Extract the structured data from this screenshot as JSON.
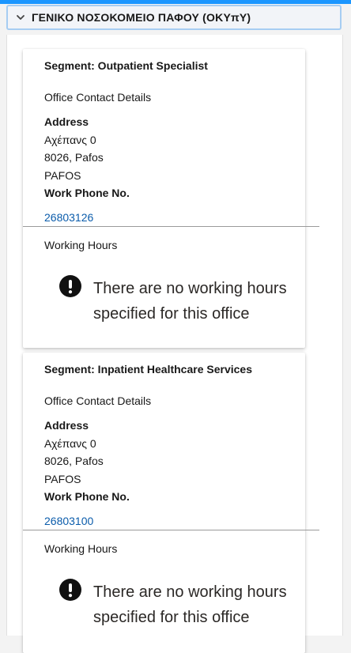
{
  "section": {
    "title": "ΓΕΝΙΚΟ ΝΟΣΟΚΟΜΕΙΟ ΠΑΦΟΥ (ΟΚΥπΥ)",
    "icon": "chevron-down-icon",
    "expanded": true
  },
  "offices": [
    {
      "segment": "Segment: Outpatient Specialist",
      "contact_heading": "Office Contact Details",
      "address_label": "Address",
      "address_lines": [
        "Αχέπανς 0",
        "8026, Pafos",
        "PAFOS"
      ],
      "phone_label": "Work Phone No.",
      "phone": "26803126",
      "hours_heading": "Working Hours",
      "hours_icon": "exclamation-circle-icon",
      "hours_notice": "There are no working hours specified for this office"
    },
    {
      "segment": "Segment: Inpatient Healthcare Services",
      "contact_heading": "Office Contact Details",
      "address_label": "Address",
      "address_lines": [
        "Αχέπανς 0",
        "8026, Pafos",
        "PAFOS"
      ],
      "phone_label": "Work Phone No.",
      "phone": "26803100",
      "hours_heading": "Working Hours",
      "hours_icon": "exclamation-circle-icon",
      "hours_notice": "There are no working hours specified for this office"
    }
  ],
  "colors": {
    "link": "#0b5cab",
    "header_border": "#a6cdf2",
    "accent": "#1b96ff"
  }
}
